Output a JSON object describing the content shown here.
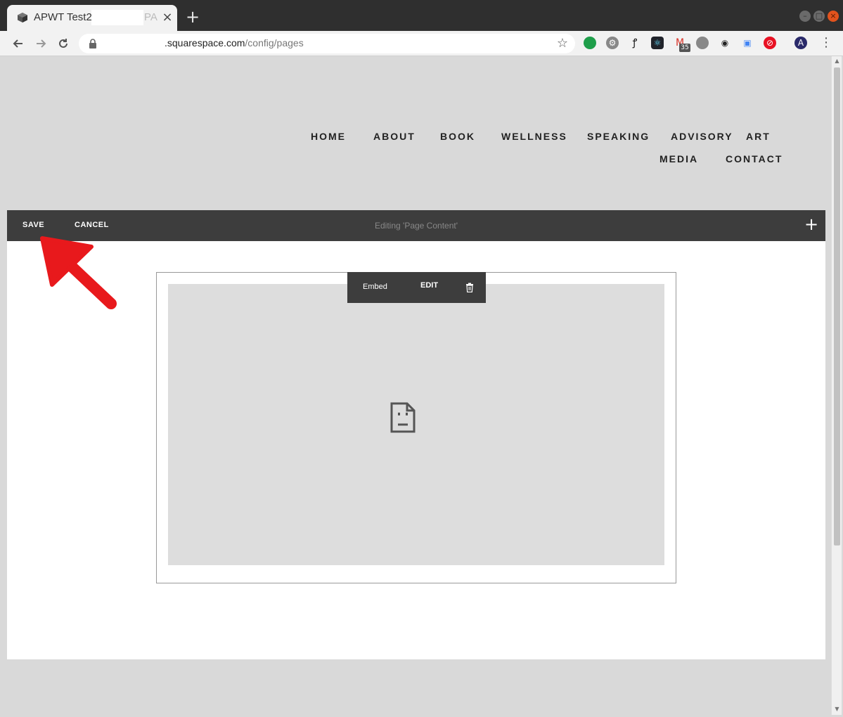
{
  "browser": {
    "tab": {
      "title": "APWT Test2",
      "title_faded": "PA",
      "close": "×"
    },
    "new_tab": "+",
    "window_buttons": {
      "minimize": "–",
      "maximize": "□",
      "close": "×"
    },
    "url": {
      "host": ".squarespace.com",
      "path": "/config/pages"
    },
    "extensions": {
      "gmail_badge": "35"
    }
  },
  "site": {
    "nav": [
      "HOME",
      "ABOUT",
      "BOOK",
      "WELLNESS",
      "SPEAKING",
      "ADVISORY",
      "ART",
      "MEDIA",
      "CONTACT"
    ]
  },
  "editor": {
    "save_label": "SAVE",
    "cancel_label": "CANCEL",
    "editing_title": "Editing 'Page Content'",
    "add_label": "+"
  },
  "block": {
    "type_label": "Embed",
    "edit_label": "EDIT"
  },
  "colors": {
    "editbar": "#3d3d3d",
    "annotation_arrow": "#e8191c",
    "page_bg": "#d9d9d9"
  }
}
